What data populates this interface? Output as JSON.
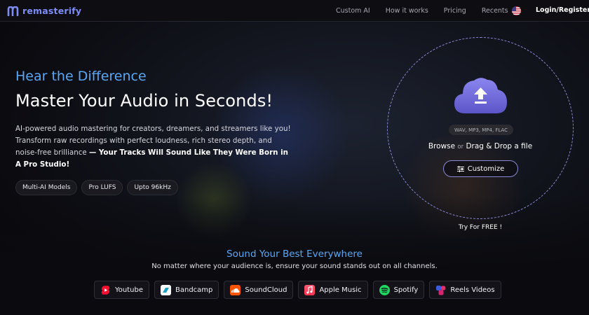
{
  "brand": {
    "name": "remasterify",
    "color": "#7d8cf7"
  },
  "nav": {
    "links": [
      "Custom AI",
      "How it works",
      "Pricing",
      "Recents"
    ],
    "flag_icon": "us-flag-icon",
    "login_label": "Login/Register"
  },
  "hero": {
    "tagline": "Hear the Difference",
    "headline": "Master Your Audio in Seconds!",
    "description_plain": "AI-powered audio mastering for creators, dreamers, and streamers like you! Transform raw recordings with perfect loudness, rich stereo depth, and noise-free brilliance",
    "description_bold": "— Your Tracks Will Sound Like They Were Born in A Pro Studio!",
    "pills": [
      "Multi-AI Models",
      "Pro LUFS",
      "Upto 96kHz"
    ],
    "accent_color": "#59a7f4"
  },
  "upload": {
    "icon": "cloud-upload-icon",
    "formats": "WAV, MP3, MP4, FLAC",
    "browse_label": "Browse",
    "or_label": "or",
    "drag_label": "Drag & Drop a file",
    "customize_label": "Customize",
    "try_label": "Try For FREE !"
  },
  "sound": {
    "title": "Sound Your Best Everywhere",
    "subtitle": "No matter where your audience is, ensure your sound stands out on all channels.",
    "platforms": [
      {
        "label": "Youtube",
        "icon": "youtube-shorts-icon"
      },
      {
        "label": "Bandcamp",
        "icon": "bandcamp-icon"
      },
      {
        "label": "SoundCloud",
        "icon": "soundcloud-icon"
      },
      {
        "label": "Apple Music",
        "icon": "apple-music-icon"
      },
      {
        "label": "Spotify",
        "icon": "spotify-icon"
      },
      {
        "label": "Reels Videos",
        "icon": "reels-icon"
      }
    ]
  }
}
